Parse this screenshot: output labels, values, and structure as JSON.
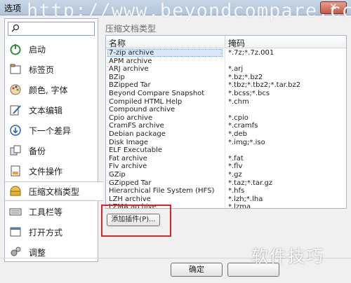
{
  "window": {
    "title": "选项",
    "close_glyph": "✕"
  },
  "watermark_url": "http://www.beyondcompare.cc/",
  "sidebar": {
    "items": [
      {
        "label": "启动",
        "icon": "power-icon"
      },
      {
        "label": "标签页",
        "icon": "tabs-icon"
      },
      {
        "label": "颜色, 字体",
        "icon": "palette-icon"
      },
      {
        "label": "文本编辑",
        "icon": "edit-icon"
      },
      {
        "label": "下一个差异",
        "icon": "next-diff-icon"
      },
      {
        "label": "备份",
        "icon": "backup-icon"
      },
      {
        "label": "文件操作",
        "icon": "file-ops-icon"
      },
      {
        "label": "压缩文档类型",
        "icon": "archive-icon",
        "selected": true
      },
      {
        "label": "工具栏等",
        "icon": "keyboard-icon"
      },
      {
        "label": "打开方式",
        "icon": "open-with-icon"
      },
      {
        "label": "调整",
        "icon": "tweak-icon"
      }
    ]
  },
  "main": {
    "title": "压缩文档类型",
    "columns": {
      "name": "名称",
      "mask": "掩码"
    },
    "rows": [
      {
        "name": "7-zip archive",
        "mask": "*.7z;*.7z.001",
        "selected": true
      },
      {
        "name": "APM archive",
        "mask": ""
      },
      {
        "name": "ARJ archive",
        "mask": "*.arj"
      },
      {
        "name": "BZip",
        "mask": "*.bz;*.bz2"
      },
      {
        "name": "BZipped Tar",
        "mask": "*.tbz;*.tbz2;*.tar.bz2"
      },
      {
        "name": "Beyond Compare Snapshot",
        "mask": "*.bcss;*.bcs"
      },
      {
        "name": "Compiled HTML Help",
        "mask": "*.chm"
      },
      {
        "name": "Compound archive",
        "mask": ""
      },
      {
        "name": "Cpio archive",
        "mask": "*.cpio"
      },
      {
        "name": "CramFS archive",
        "mask": "*.cramfs"
      },
      {
        "name": "Debian package",
        "mask": "*.deb"
      },
      {
        "name": "Disk Image",
        "mask": "*.img;*.iso"
      },
      {
        "name": "ELF Executable",
        "mask": ""
      },
      {
        "name": "Fat archive",
        "mask": "*.fat"
      },
      {
        "name": "Flv archive",
        "mask": "*.flv"
      },
      {
        "name": "GZip",
        "mask": "*.gz"
      },
      {
        "name": "GZipped Tar",
        "mask": "*.taz;*.tar.gz"
      },
      {
        "name": "Hierarchical File System (HFS)",
        "mask": "*.hfs"
      },
      {
        "name": "LZH archive",
        "mask": "*.lzh;*.lha"
      },
      {
        "name": "LZMA archive",
        "mask": "*.lzma"
      }
    ],
    "add_plugin_label": "添加插件(P)..."
  },
  "footer": {
    "ok_label": "确定",
    "cancel_label": ""
  },
  "brand_watermark": "软件技巧",
  "colors": {
    "highlight_box": "#d9242e",
    "selection": "#dce8f6"
  }
}
